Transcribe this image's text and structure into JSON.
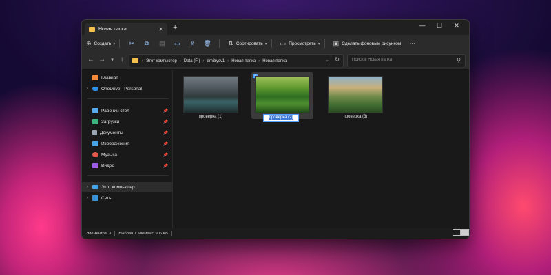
{
  "window": {
    "tab_title": "Новая папка",
    "tab_close": "✕",
    "new_tab": "+",
    "controls": {
      "minimize": "—",
      "maximize": "☐",
      "close": "✕"
    }
  },
  "commandbar": {
    "create_label": "Создать",
    "sort_label": "Сортировать",
    "view_label": "Просмотреть",
    "wallpaper_label": "Сделать фоновым рисунком",
    "more": "···"
  },
  "address": {
    "crumbs": [
      "Этот компьютер",
      "Data (F:)",
      "dmitrycv1",
      "Новая папка",
      "Новая папка"
    ],
    "search_placeholder": "Поиск в Новая папка"
  },
  "sidebar": {
    "items": [
      {
        "label": "Главная",
        "icon": "home-icon"
      },
      {
        "label": "OneDrive - Personal",
        "icon": "cloud-icon"
      },
      {
        "label": "Рабочий стол",
        "icon": "desktop-icon"
      },
      {
        "label": "Загрузки",
        "icon": "download-icon"
      },
      {
        "label": "Документы",
        "icon": "document-icon"
      },
      {
        "label": "Изображения",
        "icon": "image-icon"
      },
      {
        "label": "Музыка",
        "icon": "music-icon"
      },
      {
        "label": "Видео",
        "icon": "video-icon"
      },
      {
        "label": "Этот компьютер",
        "icon": "computer-icon"
      },
      {
        "label": "Сеть",
        "icon": "network-icon"
      }
    ]
  },
  "files": [
    {
      "name": "проверка (1)"
    },
    {
      "name": "проверка (2)"
    },
    {
      "name": "проверка (3)"
    }
  ],
  "status": {
    "count": "Элементов: 3",
    "selection": "Выбран 1 элемент: 906 КБ"
  },
  "colors": {
    "accent": "#4da3ff",
    "folder": "#f2c14e"
  }
}
